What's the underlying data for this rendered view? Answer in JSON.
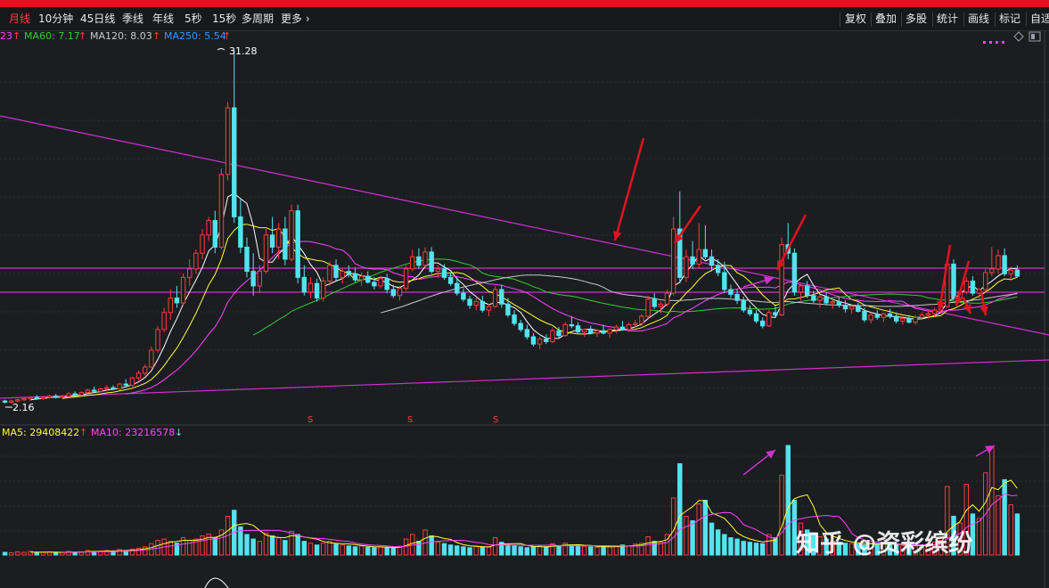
{
  "toolbar": {
    "periods": [
      "月线",
      "10分钟",
      "45日线",
      "季线",
      "年线",
      "5秒",
      "15秒",
      "多周期"
    ],
    "more_label": "更多",
    "more_chevron": "›",
    "tools": [
      "复权",
      "叠加",
      "多股",
      "统计",
      "画线",
      "标记",
      "自适"
    ]
  },
  "legend": {
    "ma_prefix": "23",
    "ma60": "MA60: 7.17",
    "ma120": "MA120: 8.03",
    "ma250": "MA250: 5.54",
    "arrow_up": "↑",
    "arrow_down": "↓",
    "vol_ma5": "MA5: 29408422",
    "vol_ma10": "MA10: 23216578"
  },
  "watermark": "知乎 @资彩缤纷",
  "colors": {
    "up": "#ff3b3b",
    "down": "#53e3ee",
    "magenta": "#cc33cc",
    "ma5": "#ffffff",
    "ma10": "#ffff33",
    "ma20": "#ff44ff",
    "ma60": "#33cc33",
    "ma120": "#c8c8c8",
    "arrow": "#e0141e"
  },
  "chart_data": {
    "type": "candlestick",
    "price_labels": {
      "high": "31.28",
      "low": "2.16"
    },
    "marker_symbol": "S",
    "candles": [
      [
        2.3,
        2.4,
        2.1,
        2.2
      ],
      [
        2.2,
        2.4,
        2.1,
        2.3
      ],
      [
        2.3,
        2.5,
        2.2,
        2.4
      ],
      [
        2.4,
        2.6,
        2.3,
        2.5
      ],
      [
        2.5,
        2.7,
        2.3,
        2.6
      ],
      [
        2.6,
        2.8,
        2.4,
        2.5
      ],
      [
        2.5,
        2.7,
        2.4,
        2.6
      ],
      [
        2.6,
        2.8,
        2.5,
        2.7
      ],
      [
        2.7,
        2.9,
        2.5,
        2.6
      ],
      [
        2.6,
        2.8,
        2.5,
        2.7
      ],
      [
        2.7,
        3.0,
        2.6,
        2.9
      ],
      [
        2.9,
        3.1,
        2.7,
        2.8
      ],
      [
        2.8,
        3.1,
        2.7,
        3.0
      ],
      [
        3.0,
        3.3,
        2.9,
        3.2
      ],
      [
        3.2,
        3.5,
        3.0,
        3.1
      ],
      [
        3.1,
        3.4,
        3.0,
        3.3
      ],
      [
        3.3,
        3.6,
        3.1,
        3.4
      ],
      [
        3.4,
        3.6,
        3.2,
        3.3
      ],
      [
        3.3,
        3.8,
        3.2,
        3.7
      ],
      [
        3.7,
        4.1,
        3.5,
        3.6
      ],
      [
        3.6,
        4.3,
        3.5,
        4.2
      ],
      [
        4.2,
        4.8,
        4.0,
        4.6
      ],
      [
        4.6,
        5.3,
        4.4,
        5.1
      ],
      [
        5.1,
        6.8,
        5.0,
        6.5
      ],
      [
        6.5,
        8.5,
        6.3,
        8.2
      ],
      [
        8.2,
        10.0,
        8.0,
        9.6
      ],
      [
        9.6,
        11.5,
        9.0,
        10.8
      ],
      [
        10.8,
        11.8,
        10.0,
        10.4
      ],
      [
        10.4,
        12.8,
        10.2,
        12.5
      ],
      [
        12.5,
        14.0,
        11.8,
        13.2
      ],
      [
        13.2,
        14.8,
        12.8,
        14.5
      ],
      [
        14.5,
        16.5,
        14.0,
        16.0
      ],
      [
        16.0,
        17.5,
        15.5,
        17.2
      ],
      [
        17.2,
        18.0,
        14.5,
        15.0
      ],
      [
        15.0,
        21.5,
        14.8,
        21.0
      ],
      [
        21.0,
        27.0,
        20.5,
        26.5
      ],
      [
        26.5,
        31.28,
        17.0,
        17.5
      ],
      [
        17.5,
        19.0,
        14.5,
        15.0
      ],
      [
        15.0,
        15.8,
        12.5,
        13.0
      ],
      [
        13.0,
        14.5,
        11.0,
        11.8
      ],
      [
        11.8,
        13.5,
        11.2,
        13.0
      ],
      [
        13.0,
        16.5,
        12.8,
        16.0
      ],
      [
        16.0,
        17.5,
        14.5,
        15.0
      ],
      [
        15.0,
        17.0,
        14.0,
        16.5
      ],
      [
        16.5,
        17.5,
        13.5,
        14.0
      ],
      [
        14.0,
        18.5,
        13.8,
        18.0
      ],
      [
        18.0,
        18.5,
        12.0,
        12.5
      ],
      [
        12.5,
        13.5,
        11.0,
        11.3
      ],
      [
        11.3,
        12.5,
        10.8,
        12.0
      ],
      [
        12.0,
        12.4,
        10.5,
        10.8
      ],
      [
        10.8,
        12.5,
        10.5,
        12.2
      ],
      [
        12.2,
        13.8,
        11.8,
        13.5
      ],
      [
        13.5,
        14.0,
        12.2,
        12.5
      ],
      [
        12.5,
        13.2,
        12.0,
        13.0
      ],
      [
        13.0,
        13.5,
        12.5,
        12.8
      ],
      [
        12.8,
        13.3,
        12.1,
        12.3
      ],
      [
        12.3,
        12.9,
        11.8,
        12.6
      ],
      [
        12.6,
        13.0,
        12.0,
        12.1
      ],
      [
        12.1,
        12.5,
        11.5,
        11.8
      ],
      [
        11.8,
        12.6,
        11.6,
        12.4
      ],
      [
        12.4,
        12.8,
        11.2,
        11.5
      ],
      [
        11.5,
        11.9,
        10.8,
        11.0
      ],
      [
        11.0,
        11.8,
        10.6,
        11.6
      ],
      [
        11.6,
        13.5,
        11.4,
        13.2
      ],
      [
        13.2,
        14.8,
        13.0,
        14.2
      ],
      [
        14.2,
        14.9,
        13.2,
        13.5
      ],
      [
        13.5,
        15.0,
        13.3,
        14.6
      ],
      [
        14.6,
        15.0,
        12.8,
        13.0
      ],
      [
        13.0,
        13.5,
        12.5,
        13.2
      ],
      [
        13.2,
        13.6,
        12.3,
        12.5
      ],
      [
        12.5,
        12.9,
        11.8,
        12.0
      ],
      [
        12.0,
        12.5,
        11.0,
        11.2
      ],
      [
        11.2,
        11.6,
        10.5,
        10.7
      ],
      [
        10.7,
        11.0,
        9.9,
        10.2
      ],
      [
        10.2,
        10.8,
        9.8,
        10.5
      ],
      [
        10.5,
        11.0,
        9.6,
        9.8
      ],
      [
        9.8,
        10.3,
        9.3,
        10.1
      ],
      [
        10.1,
        11.8,
        10.0,
        11.5
      ],
      [
        11.5,
        11.9,
        10.0,
        10.3
      ],
      [
        10.3,
        10.8,
        9.2,
        9.4
      ],
      [
        9.4,
        9.8,
        8.5,
        8.7
      ],
      [
        8.7,
        9.0,
        8.0,
        8.2
      ],
      [
        8.2,
        8.6,
        7.4,
        7.6
      ],
      [
        7.6,
        7.9,
        6.8,
        7.0
      ],
      [
        7.0,
        7.6,
        6.6,
        7.4
      ],
      [
        7.4,
        7.8,
        7.0,
        7.2
      ],
      [
        7.2,
        8.3,
        7.1,
        8.1
      ],
      [
        8.1,
        8.4,
        7.5,
        7.7
      ],
      [
        7.7,
        8.8,
        7.6,
        8.6
      ],
      [
        8.6,
        9.3,
        8.3,
        8.5
      ],
      [
        8.5,
        8.8,
        7.9,
        8.0
      ],
      [
        8.0,
        8.3,
        7.6,
        8.2
      ],
      [
        8.2,
        8.5,
        7.8,
        7.9
      ],
      [
        7.9,
        8.2,
        7.6,
        8.1
      ],
      [
        8.1,
        8.6,
        7.8,
        7.9
      ],
      [
        7.9,
        8.3,
        7.5,
        8.2
      ],
      [
        8.2,
        8.6,
        7.9,
        8.4
      ],
      [
        8.4,
        8.9,
        8.1,
        8.2
      ],
      [
        8.2,
        8.8,
        8.0,
        8.6
      ],
      [
        8.6,
        9.0,
        8.3,
        8.7
      ],
      [
        8.7,
        9.5,
        8.5,
        9.3
      ],
      [
        9.3,
        11.0,
        9.1,
        10.7
      ],
      [
        10.7,
        11.2,
        9.9,
        10.1
      ],
      [
        10.1,
        10.5,
        9.5,
        10.3
      ],
      [
        10.3,
        11.5,
        10.1,
        11.2
      ],
      [
        11.2,
        17.5,
        11.0,
        16.5
      ],
      [
        16.5,
        19.6,
        12.0,
        12.5
      ],
      [
        12.5,
        14.8,
        12.1,
        14.2
      ],
      [
        14.2,
        15.5,
        13.2,
        13.6
      ],
      [
        13.6,
        17.0,
        13.2,
        14.8
      ],
      [
        14.8,
        16.8,
        14.0,
        14.2
      ],
      [
        14.2,
        14.8,
        13.0,
        13.5
      ],
      [
        13.5,
        14.0,
        12.6,
        12.9
      ],
      [
        12.9,
        13.8,
        11.2,
        11.5
      ],
      [
        11.5,
        11.9,
        10.8,
        11.1
      ],
      [
        11.1,
        11.5,
        10.3,
        10.6
      ],
      [
        10.6,
        10.9,
        9.6,
        9.8
      ],
      [
        9.8,
        10.2,
        9.3,
        9.5
      ],
      [
        9.5,
        9.8,
        8.7,
        8.9
      ],
      [
        8.9,
        9.2,
        8.3,
        8.5
      ],
      [
        8.5,
        9.8,
        8.4,
        9.6
      ],
      [
        9.6,
        10.2,
        9.2,
        9.4
      ],
      [
        9.4,
        15.8,
        9.3,
        15.2
      ],
      [
        15.2,
        17.0,
        14.0,
        14.5
      ],
      [
        14.5,
        14.9,
        11.0,
        11.3
      ],
      [
        11.3,
        12.0,
        10.6,
        11.8
      ],
      [
        11.8,
        12.2,
        10.8,
        11.0
      ],
      [
        11.0,
        11.4,
        10.4,
        10.6
      ],
      [
        10.6,
        11.1,
        10.0,
        10.9
      ],
      [
        10.9,
        11.3,
        10.2,
        10.4
      ],
      [
        10.4,
        10.7,
        9.9,
        10.5
      ],
      [
        10.5,
        10.9,
        10.0,
        10.2
      ],
      [
        10.2,
        10.6,
        9.6,
        9.9
      ],
      [
        9.9,
        10.3,
        9.5,
        10.1
      ],
      [
        10.1,
        10.4,
        9.6,
        9.7
      ],
      [
        9.7,
        10.0,
        8.8,
        9.0
      ],
      [
        9.0,
        9.6,
        8.7,
        9.4
      ],
      [
        9.4,
        9.8,
        9.0,
        9.2
      ],
      [
        9.2,
        9.6,
        8.8,
        9.5
      ],
      [
        9.5,
        9.9,
        9.1,
        9.3
      ],
      [
        9.3,
        9.6,
        8.7,
        8.9
      ],
      [
        8.9,
        9.3,
        8.6,
        9.1
      ],
      [
        9.1,
        9.4,
        8.7,
        8.8
      ],
      [
        8.8,
        9.4,
        8.6,
        9.2
      ],
      [
        9.2,
        9.6,
        9.0,
        9.4
      ],
      [
        9.4,
        9.8,
        9.1,
        9.5
      ],
      [
        9.5,
        10.0,
        9.2,
        9.8
      ],
      [
        9.8,
        10.3,
        9.6,
        10.1
      ],
      [
        10.1,
        14.0,
        10.0,
        13.6
      ],
      [
        13.6,
        14.0,
        10.6,
        10.8
      ],
      [
        10.8,
        11.5,
        10.5,
        11.3
      ],
      [
        11.3,
        12.5,
        11.1,
        12.2
      ],
      [
        12.2,
        12.6,
        11.0,
        11.2
      ],
      [
        11.2,
        11.6,
        10.8,
        11.5
      ],
      [
        11.5,
        13.2,
        11.3,
        12.9
      ],
      [
        12.9,
        15.0,
        12.6,
        13.2
      ],
      [
        13.2,
        14.8,
        12.8,
        14.3
      ],
      [
        14.3,
        14.9,
        12.6,
        12.8
      ],
      [
        12.8,
        13.4,
        12.2,
        13.1
      ],
      [
        13.1,
        13.5,
        12.5,
        12.6
      ]
    ],
    "volume": [
      0.6,
      0.5,
      0.7,
      0.6,
      0.8,
      0.5,
      0.6,
      0.7,
      0.5,
      0.6,
      0.8,
      0.6,
      0.7,
      1.0,
      0.8,
      0.9,
      1.0,
      0.8,
      1.2,
      1.0,
      1.3,
      1.5,
      1.8,
      2.5,
      3.2,
      3.5,
      3.0,
      2.6,
      3.8,
      3.2,
      3.5,
      4.2,
      4.6,
      3.8,
      5.5,
      8.5,
      9.8,
      6.2,
      4.5,
      3.5,
      3.0,
      4.8,
      4.2,
      3.8,
      3.2,
      5.2,
      4.5,
      3.0,
      2.6,
      2.2,
      2.6,
      3.0,
      2.4,
      2.2,
      2.0,
      1.8,
      2.0,
      1.7,
      1.6,
      1.8,
      1.6,
      1.5,
      1.9,
      3.5,
      4.5,
      3.0,
      5.5,
      4.2,
      2.8,
      2.5,
      2.2,
      2.0,
      1.8,
      1.6,
      2.0,
      1.8,
      1.7,
      3.8,
      2.8,
      2.2,
      2.0,
      1.8,
      1.6,
      1.8,
      2.0,
      1.8,
      2.5,
      2.0,
      2.6,
      2.2,
      2.0,
      1.9,
      1.8,
      1.7,
      1.9,
      1.8,
      2.0,
      2.2,
      2.0,
      2.4,
      2.6,
      4.0,
      3.0,
      2.8,
      4.5,
      12.5,
      20.0,
      8.5,
      7.5,
      11.2,
      12.0,
      7.0,
      5.5,
      4.5,
      3.8,
      3.5,
      3.0,
      2.8,
      2.6,
      2.5,
      4.5,
      3.8,
      17.5,
      24.0,
      12.0,
      7.0,
      5.5,
      4.8,
      4.0,
      3.5,
      3.0,
      2.8,
      2.6,
      2.5,
      2.4,
      2.2,
      2.6,
      2.5,
      2.4,
      2.3,
      2.2,
      2.0,
      1.9,
      2.0,
      2.2,
      2.4,
      2.8,
      3.2,
      15.0,
      8.5,
      7.0,
      15.5,
      9.0,
      8.0,
      18.0,
      23.5,
      13.0,
      16.5,
      11.0,
      9.0
    ]
  }
}
